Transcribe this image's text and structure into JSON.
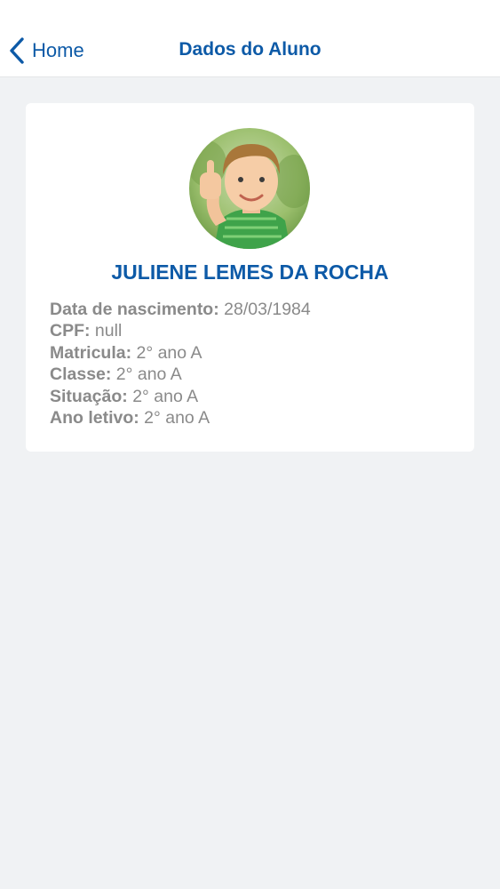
{
  "nav": {
    "back_label": "Home",
    "title": "Dados do Aluno"
  },
  "student": {
    "name": "JULIENE LEMES DA ROCHA",
    "fields": [
      {
        "label": "Data de nascimento:",
        "value": "28/03/1984"
      },
      {
        "label": "CPF:",
        "value": "null"
      },
      {
        "label": "Matricula:",
        "value": "2° ano A"
      },
      {
        "label": "Classe:",
        "value": "2° ano A"
      },
      {
        "label": "Situação:",
        "value": "2° ano A"
      },
      {
        "label": "Ano letivo:",
        "value": "2° ano A"
      }
    ]
  },
  "icons": {
    "back": "chevron-left-icon",
    "avatar": "student-photo"
  },
  "colors": {
    "accent": "#0d5aa7",
    "background": "#f0f2f4",
    "card": "#ffffff",
    "text_muted": "#8a8a8a"
  }
}
